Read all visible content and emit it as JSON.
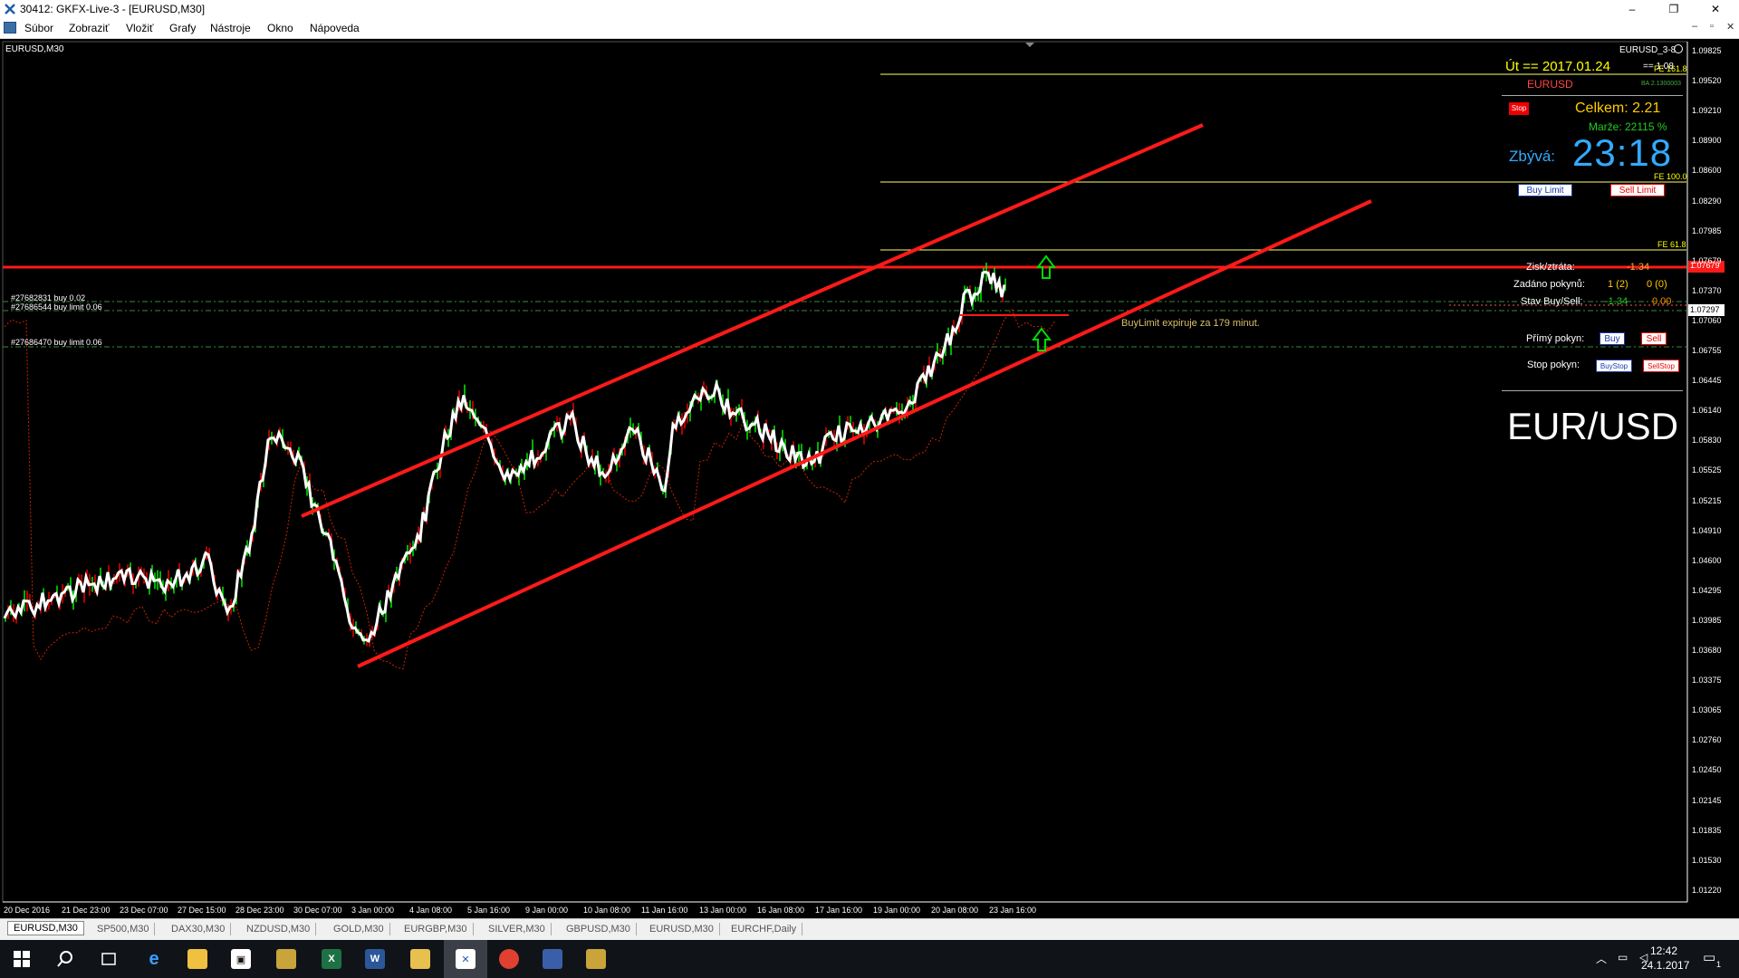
{
  "window": {
    "title": "30412: GKFX-Live-3 - [EURUSD,M30]",
    "minimize_label": "–",
    "restore_label": "❐",
    "close_label": "✕"
  },
  "menu": {
    "items": [
      "Súbor",
      "Zobraziť",
      "Vložiť",
      "Grafy",
      "Nástroje",
      "Okno",
      "Nápoveda"
    ],
    "mdi_minimize": "–",
    "mdi_restore": "▫",
    "mdi_close": "✕"
  },
  "chart": {
    "symbol_label": "EURUSD,M30",
    "indicator_label": "EURUSD_3-8",
    "price_axis": [
      "1.09825",
      "1.09520",
      "1.09210",
      "1.08900",
      "1.08600",
      "1.08290",
      "1.07985",
      "1.07679",
      "1.07370",
      "1.07060",
      "1.06755",
      "1.06445",
      "1.06140",
      "1.05830",
      "1.05525",
      "1.05215",
      "1.04910",
      "1.04600",
      "1.04295",
      "1.03985",
      "1.03680",
      "1.03375",
      "1.03065",
      "1.02760",
      "1.02450",
      "1.02145",
      "1.01835",
      "1.01530",
      "1.01220"
    ],
    "current_price_tag": "1.07297",
    "red_line_price_tag": "1.07679",
    "time_axis": [
      "20 Dec 2016",
      "21 Dec 23:00",
      "23 Dec 07:00",
      "27 Dec 15:00",
      "28 Dec 23:00",
      "30 Dec 07:00",
      "3 Jan 00:00",
      "4 Jan 08:00",
      "5 Jan 16:00",
      "9 Jan 00:00",
      "10 Jan 08:00",
      "11 Jan 16:00",
      "13 Jan 00:00",
      "16 Jan 08:00",
      "17 Jan 16:00",
      "19 Jan 00:00",
      "20 Jan 08:00",
      "23 Jan 16:00"
    ],
    "orders": [
      "#27682831 buy 0.02",
      "#27686544 buy limit 0.06",
      "#27686470 buy limit 0.06"
    ],
    "fib_labels": [
      "FE 161.8",
      "FE 100.0",
      "FE 61.8"
    ],
    "buylimit_note": "BuyLimit expiruje za 179 minut.",
    "colors": {
      "candle_up": "#00ff00",
      "candle_down": "#ff0000",
      "line": "#ffffff",
      "channel": "#ff1a1a",
      "fib": "#ffff66",
      "dotted": "#cc2200"
    }
  },
  "panel": {
    "date_label": "Út  ==  2017.01.24",
    "date_suffix": "== 1.08",
    "symbol": "EURUSD",
    "small_code": "BA 2.1300003",
    "stop_label": "Stop",
    "total_label": "Celkem: 2.21",
    "margin_label": "Marže:  22115 %",
    "remaining_label": "Zbývá:",
    "remaining_value": "23:18",
    "buy_limit_btn": "Buy Limit",
    "sell_limit_btn": "Sell Limit",
    "pnl_label": "Zisk/ztráta:",
    "pnl_value": "-1.34",
    "orders_label": "Zadáno pokynů:",
    "orders_buy": "1 (2)",
    "orders_sell": "0 (0)",
    "state_label": "Stav Buy/Sell:",
    "state_buy": "-1.34",
    "state_sell": "0.00",
    "direct_label": "Přímý pokyn:",
    "buy_btn": "Buy",
    "sell_btn": "Sell",
    "stop_order_label": "Stop pokyn:",
    "buystop_btn": "BuyStop",
    "sellstop_btn": "SellStop",
    "pair_big": "EUR/USD"
  },
  "tabs": [
    "EURUSD,M30",
    "SP500,M30",
    "DAX30,M30",
    "NZDUSD,M30",
    "GOLD,M30",
    "EURGBP,M30",
    "SILVER,M30",
    "GBPUSD,M30",
    "EURUSD,M30",
    "EURCHF,Daily"
  ],
  "taskbar": {
    "time": "12:42",
    "date": "24.1.2017",
    "notification_count": "1"
  }
}
